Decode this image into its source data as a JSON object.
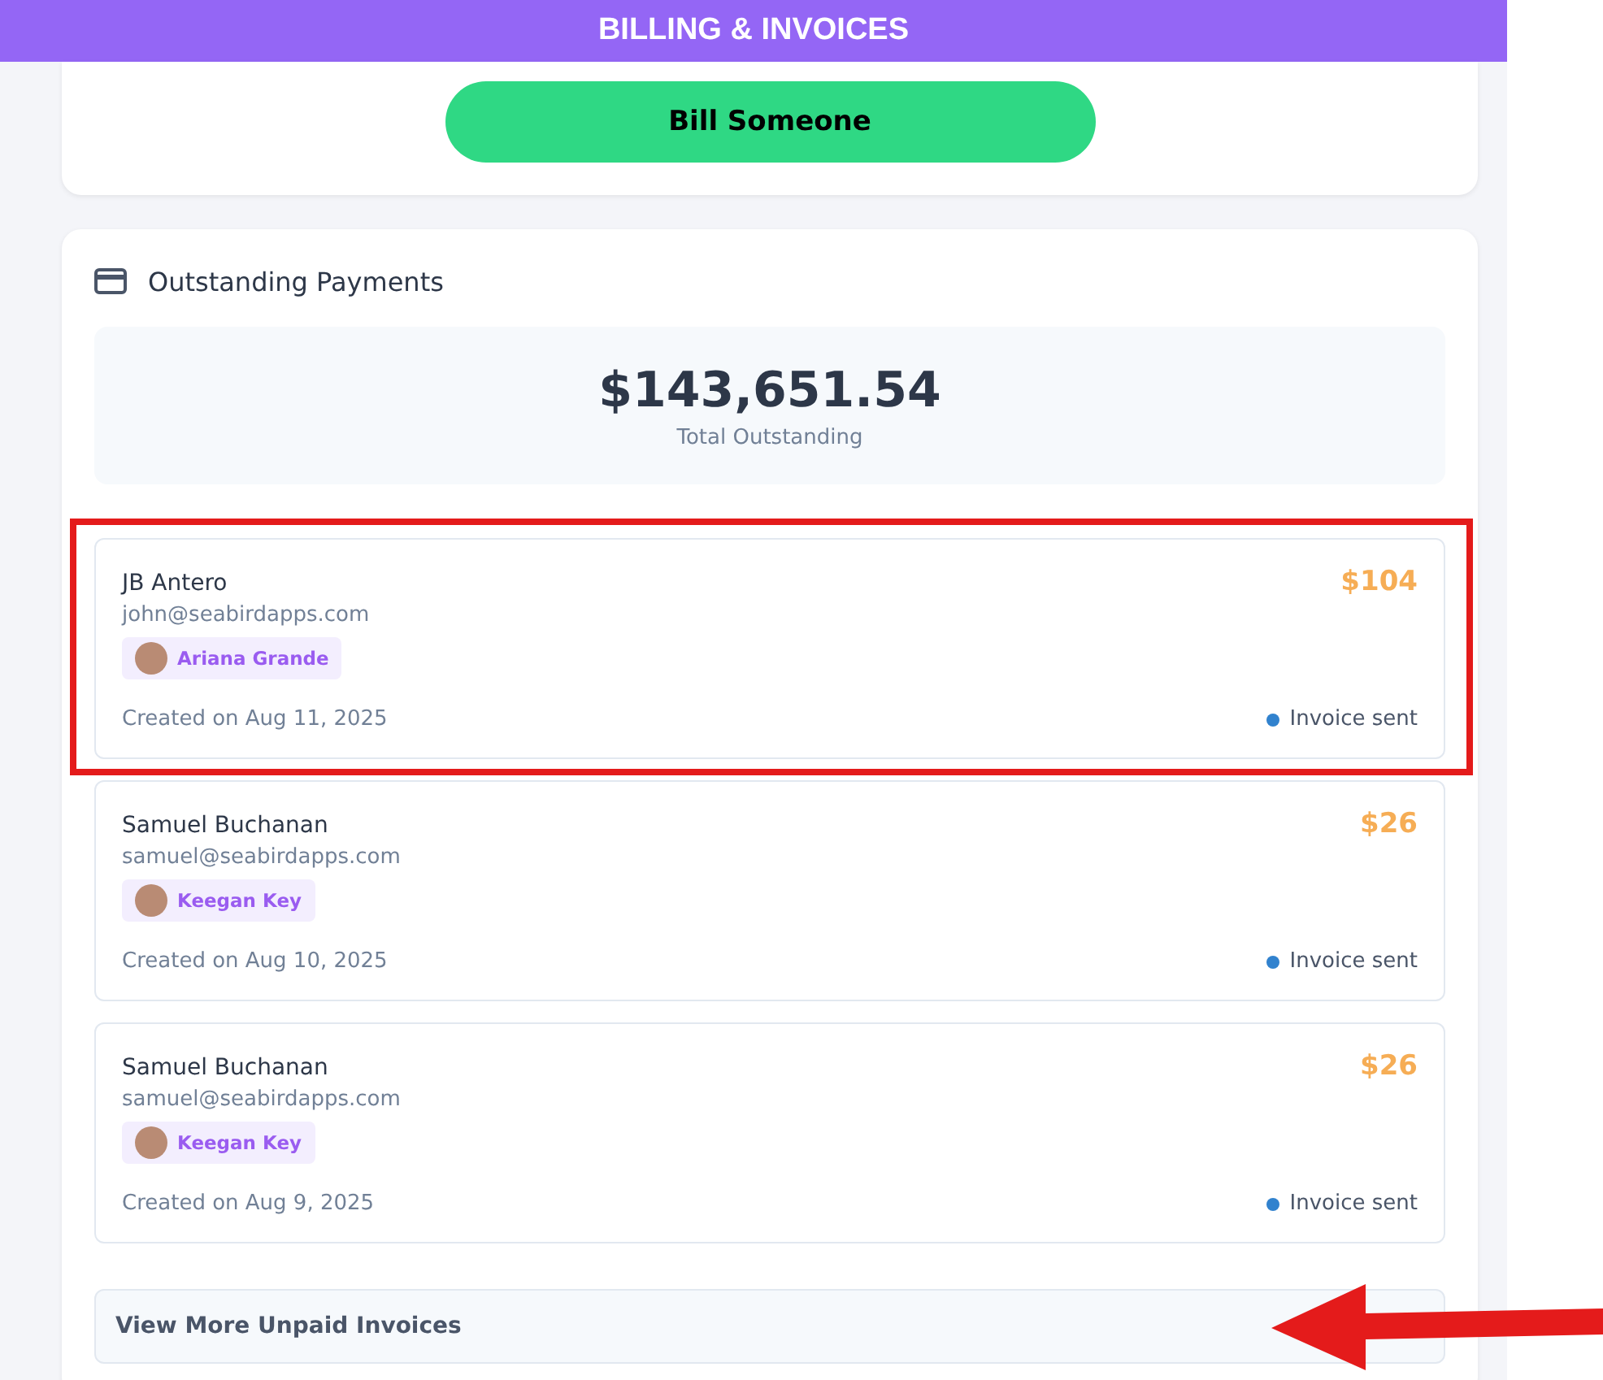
{
  "header": {
    "title": "BILLING & INVOICES"
  },
  "bill_button": {
    "label": "Bill Someone"
  },
  "outstanding": {
    "title": "Outstanding Payments",
    "total": "$143,651.54",
    "total_label": "Total Outstanding",
    "invoices": [
      {
        "name": "JB Antero",
        "email": "john@seabirdapps.com",
        "assignee": "Ariana Grande",
        "amount": "$104",
        "created": "Created on Aug 11, 2025",
        "status": "Invoice sent",
        "color": "#3182ce",
        "highlighted": true
      },
      {
        "name": "Samuel Buchanan",
        "email": "samuel@seabirdapps.com",
        "assignee": "Keegan Key",
        "amount": "$26",
        "created": "Created on Aug 10, 2025",
        "status": "Invoice sent",
        "color": "#3182ce",
        "highlighted": false
      },
      {
        "name": "Samuel Buchanan",
        "email": "samuel@seabirdapps.com",
        "assignee": "Keegan Key",
        "amount": "$26",
        "created": "Created on Aug 9, 2025",
        "status": "Invoice sent",
        "color": "#3182ce",
        "highlighted": false
      }
    ],
    "view_more": {
      "label": "View More Unpaid Invoices",
      "arrow_pointer": true
    }
  }
}
